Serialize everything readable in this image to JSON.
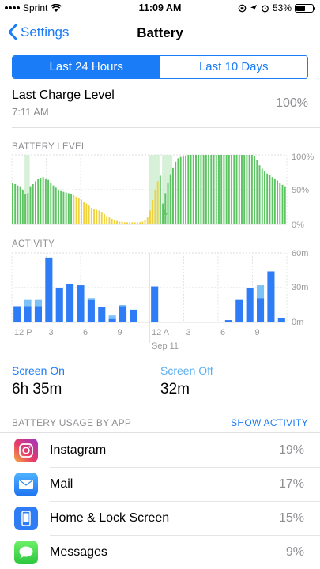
{
  "status_bar": {
    "carrier": "Sprint",
    "time": "11:09 AM",
    "battery_percent": "53%",
    "battery_level": 0.53
  },
  "nav": {
    "back_label": "Settings",
    "title": "Battery"
  },
  "segments": {
    "active": "Last 24 Hours",
    "inactive": "Last 10 Days"
  },
  "last_charge": {
    "title": "Last Charge Level",
    "time": "7:11 AM",
    "value": "100%"
  },
  "battery_chart": {
    "title": "BATTERY LEVEL",
    "y_ticks": [
      "100%",
      "50%",
      "0%"
    ]
  },
  "activity_chart": {
    "title": "ACTIVITY",
    "y_ticks": [
      "60m",
      "30m",
      "0m"
    ],
    "x_ticks": [
      "12 P",
      "3",
      "6",
      "9",
      "12 A",
      "3",
      "6",
      "9"
    ],
    "date_label": "Sep 11"
  },
  "chart_data": [
    {
      "type": "bar",
      "title": "BATTERY LEVEL",
      "ylabel": "",
      "ylim": [
        0,
        100
      ],
      "values": [
        60,
        58,
        56,
        55,
        50,
        44,
        45,
        55,
        58,
        62,
        65,
        67,
        68,
        66,
        64,
        60,
        56,
        53,
        50,
        48,
        47,
        46,
        45,
        44,
        42,
        40,
        38,
        36,
        33,
        30,
        27,
        24,
        22,
        21,
        20,
        18,
        15,
        12,
        10,
        8,
        6,
        5,
        4,
        4,
        3,
        3,
        3,
        3,
        3,
        3,
        3,
        4,
        6,
        10,
        20,
        35,
        50,
        62,
        70,
        30,
        45,
        60,
        72,
        82,
        90,
        95,
        97,
        98,
        99,
        100,
        100,
        100,
        100,
        100,
        100,
        100,
        100,
        100,
        100,
        100,
        100,
        100,
        100,
        100,
        100,
        100,
        100,
        100,
        100,
        100,
        100,
        100,
        100,
        100,
        100,
        98,
        92,
        85,
        80,
        76,
        73,
        71,
        68,
        66,
        63,
        60,
        57,
        55
      ],
      "low_power_range": [
        24,
        58
      ],
      "colors": {
        "normal": "#5cc562",
        "low_power": "#f0d23c",
        "charging_bg": "#cdeecf"
      }
    },
    {
      "type": "bar",
      "title": "ACTIVITY",
      "ylim": [
        0,
        60
      ],
      "x_ticks": [
        "12 P",
        "3",
        "6",
        "9",
        "12 A",
        "3",
        "6",
        "9"
      ],
      "series": [
        {
          "name": "Screen On",
          "values": [
            14,
            14,
            14,
            56,
            30,
            33,
            32,
            20,
            13,
            3,
            14,
            11,
            0,
            31,
            0,
            0,
            0,
            0,
            0,
            0,
            2,
            20,
            30,
            21,
            44,
            4
          ]
        },
        {
          "name": "Screen Off",
          "values": [
            0,
            6,
            6,
            0,
            0,
            0,
            0,
            1,
            0,
            3,
            1,
            0,
            0,
            0,
            0,
            0,
            0,
            0,
            0,
            0,
            0,
            0,
            0,
            11,
            0,
            0
          ]
        }
      ],
      "colors": {
        "screen_on": "#2e7cf6",
        "screen_off": "#7dc2f6"
      }
    }
  ],
  "screen_time": {
    "on_label": "Screen On",
    "on_value": "6h 35m",
    "off_label": "Screen Off",
    "off_value": "32m"
  },
  "usage": {
    "header": "BATTERY USAGE BY APP",
    "action": "SHOW ACTIVITY",
    "apps": [
      {
        "name": "Instagram",
        "percent": "19%",
        "icon": "instagram-icon"
      },
      {
        "name": "Mail",
        "percent": "17%",
        "icon": "mail-icon"
      },
      {
        "name": "Home & Lock Screen",
        "percent": "15%",
        "icon": "phone-icon"
      },
      {
        "name": "Messages",
        "percent": "9%",
        "icon": "messages-icon"
      }
    ]
  }
}
